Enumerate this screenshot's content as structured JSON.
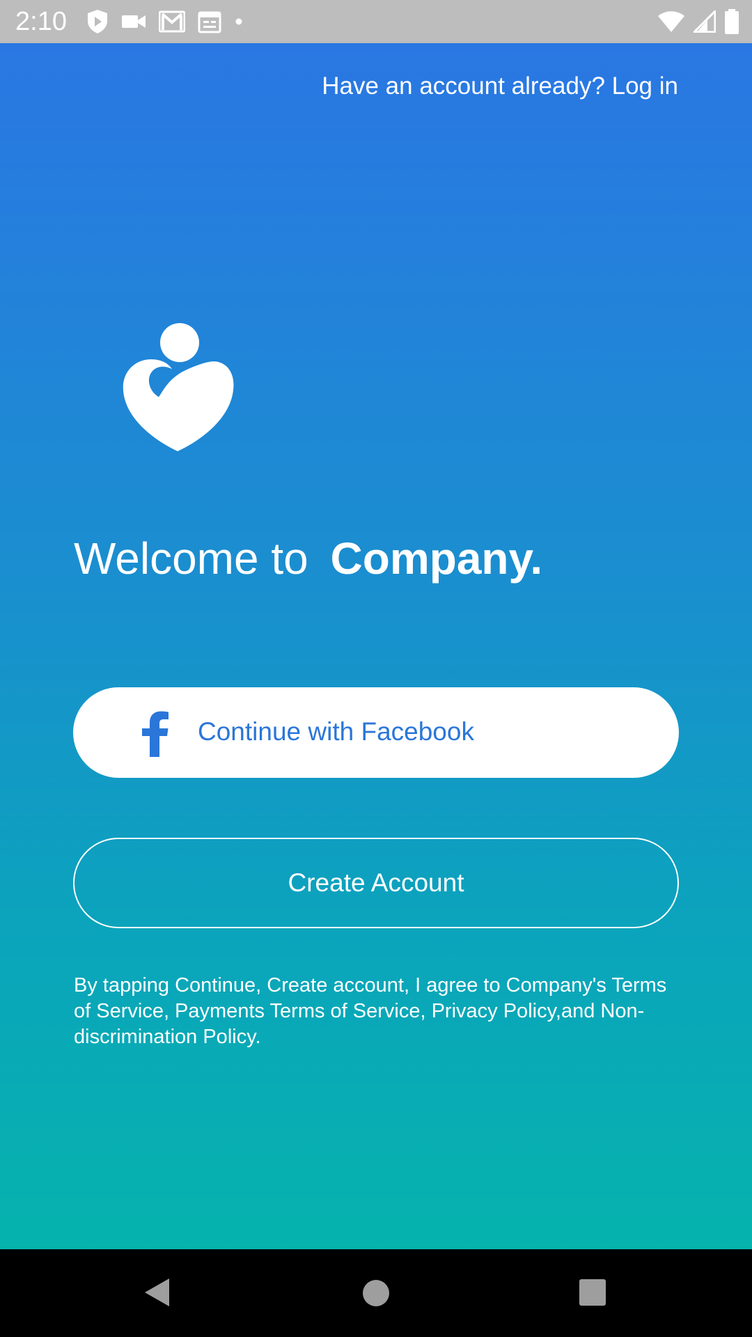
{
  "status_bar": {
    "time": "2:10",
    "left_icons": [
      "shield-play-icon",
      "video-camera-icon",
      "gmail-icon",
      "calendar-icon",
      "dot-icon"
    ],
    "right_icons": [
      "wifi-icon",
      "cellular-signal-icon",
      "battery-icon"
    ]
  },
  "header": {
    "login_prompt": "Have an account already? Log in"
  },
  "hero": {
    "logo_icon": "mother-heart-logo-icon",
    "welcome_text": "Welcome to",
    "brand_name": "Company."
  },
  "actions": {
    "facebook_button_label": "Continue with Facebook",
    "facebook_icon": "facebook-f-icon",
    "create_account_label": "Create Account"
  },
  "legal": {
    "terms_text": "By tapping Continue, Create account, I agree to Company's Terms of Service, Payments Terms of Service, Privacy Policy,and Non-discrimination Policy."
  },
  "navigation": {
    "buttons": [
      "back-icon",
      "home-icon",
      "recents-icon"
    ]
  },
  "colors": {
    "gradient_top": "#2a77e3",
    "gradient_bottom": "#06b3ad",
    "facebook_text": "#2a76d9",
    "status_bar_bg": "#bdbdbd"
  }
}
